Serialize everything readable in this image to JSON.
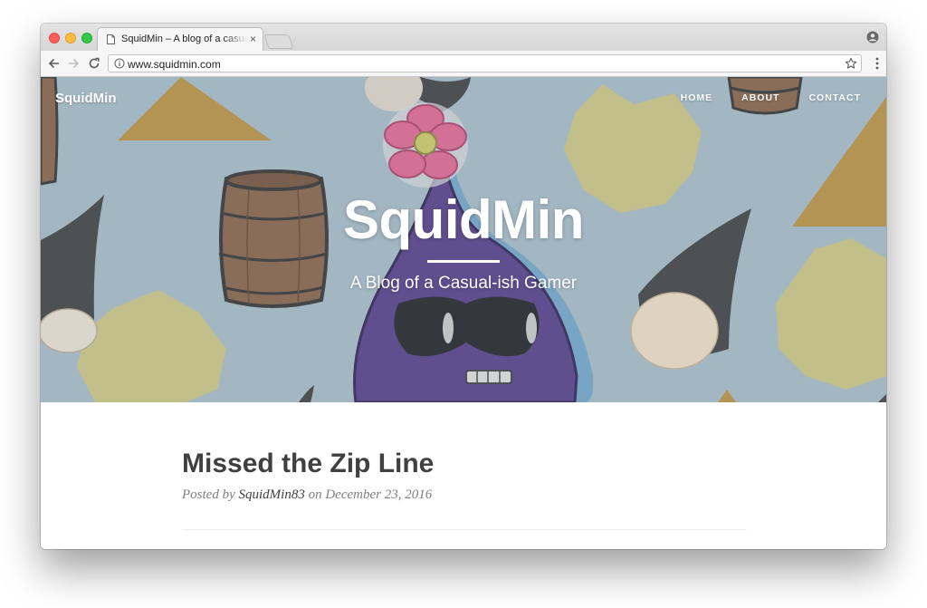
{
  "browser": {
    "tab": {
      "title": "SquidMin – A blog of a casual-ish Gamer",
      "icon": "document-icon"
    },
    "url": "www.squidmin.com",
    "icons": {
      "back": "arrow-left-icon",
      "forward": "arrow-right-icon",
      "reload": "reload-icon",
      "info": "info-icon",
      "bookmark": "star-icon",
      "menu": "kebab-menu-icon",
      "profile": "profile-icon",
      "close_tab": "×"
    }
  },
  "site": {
    "brand": "SquidMin",
    "nav": [
      "HOME",
      "ABOUT",
      "CONTACT"
    ],
    "hero": {
      "title": "SquidMin",
      "subtitle": "A Blog of a Casual-ish Gamer"
    }
  },
  "post": {
    "title": "Missed the Zip Line",
    "posted_by": "Posted by",
    "author": "SquidMin83",
    "on": "on",
    "date": "December 23, 2016"
  },
  "colors": {
    "hero_bg": "#a8bbc7",
    "squid": "#5e4a8f",
    "star": "#c9c48a",
    "triangle": "#b9954f",
    "barrel": "#8b6b53",
    "title_text": "#404040",
    "meta_text": "#808080"
  }
}
